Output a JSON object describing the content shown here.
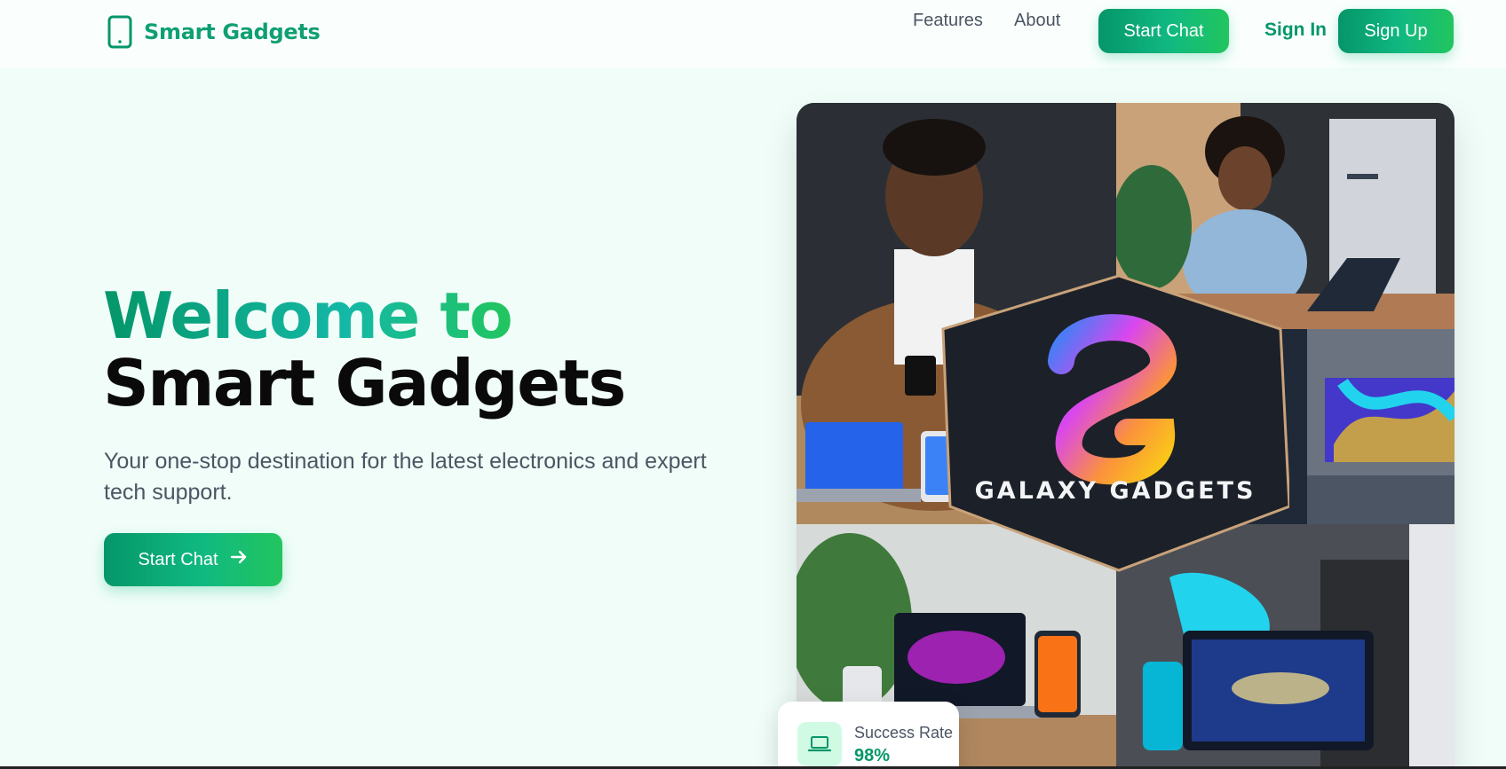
{
  "navbar": {
    "brand": "Smart Gadgets",
    "brand_icon": "smartphone-icon",
    "links": [
      "Features",
      "About"
    ],
    "start_chat_label": "Start Chat",
    "sign_in_label": "Sign In",
    "sign_up_label": "Sign Up"
  },
  "hero": {
    "title_line1": "Welcome to",
    "title_line2": "Smart Gadgets",
    "subtitle": "Your one-stop destination for the latest electronics and expert tech support.",
    "cta_label": "Start Chat",
    "cta_icon": "arrow-right-icon"
  },
  "hero_image": {
    "logo_text": "GALAXY GADGETS"
  },
  "stat_card": {
    "icon": "laptop-icon",
    "label": "Success Rate",
    "value": "98%"
  },
  "colors": {
    "brand": "#059669",
    "accent_gradient_end": "#22c55e",
    "background": "#f0fdf8"
  }
}
